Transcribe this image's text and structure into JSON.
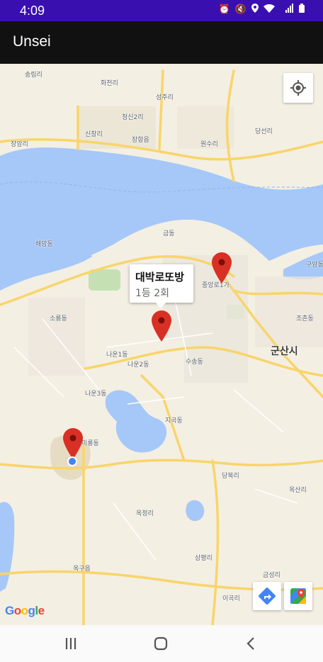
{
  "status_bar": {
    "time": "4:09",
    "icons": [
      "alarm-icon",
      "mute-icon",
      "location-icon",
      "wifi-icon",
      "hd-signal-icon",
      "battery-icon"
    ]
  },
  "app_bar": {
    "title": "Unsei"
  },
  "map": {
    "attribution": "Google",
    "city_label": "군산시",
    "places": [
      {
        "name": "화천리"
      },
      {
        "name": "송림리"
      },
      {
        "name": "성주리"
      },
      {
        "name": "청신2리"
      },
      {
        "name": "신창리"
      },
      {
        "name": "장항읍"
      },
      {
        "name": "장암리"
      },
      {
        "name": "원수리"
      },
      {
        "name": "당선리"
      },
      {
        "name": "해망동"
      },
      {
        "name": "금동"
      },
      {
        "name": "구암동"
      },
      {
        "name": "중앙로1가"
      },
      {
        "name": "소룡동"
      },
      {
        "name": "조촌동"
      },
      {
        "name": "나운1동"
      },
      {
        "name": "나운2동"
      },
      {
        "name": "수송동"
      },
      {
        "name": "나운3동"
      },
      {
        "name": "지곡동"
      },
      {
        "name": "미룡동"
      },
      {
        "name": "당북리"
      },
      {
        "name": "옥산리"
      },
      {
        "name": "옥정리"
      },
      {
        "name": "상평리"
      },
      {
        "name": "옥구읍"
      },
      {
        "name": "금성리"
      },
      {
        "name": "이곡리"
      }
    ],
    "info_window": {
      "title": "대박로또방",
      "snippet": "1등 2회"
    },
    "markers": [
      {
        "name": "marker-north"
      },
      {
        "name": "marker-selected"
      },
      {
        "name": "marker-west"
      }
    ],
    "colors": {
      "water": "#a6c8f8",
      "land": "#f4efe3",
      "road": "#f8d56b",
      "marker": "#d93025"
    }
  },
  "nav_bar": {
    "buttons": [
      "recent-apps-icon",
      "home-icon",
      "back-icon"
    ]
  }
}
